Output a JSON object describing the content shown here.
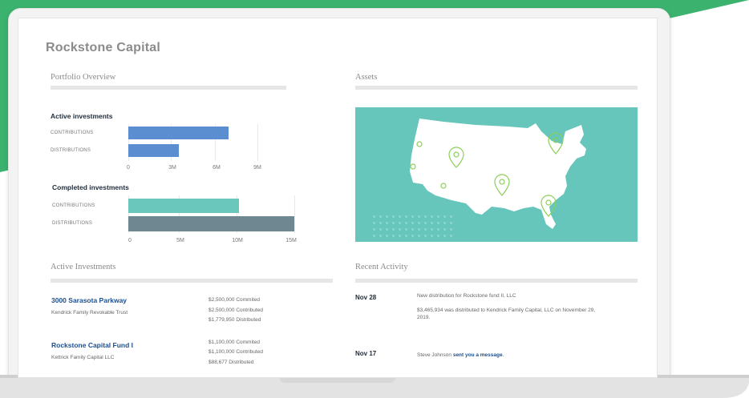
{
  "app": {
    "title": "Rockstone Capital"
  },
  "sections": {
    "portfolio_overview": "Portfolio Overview",
    "assets": "Assets",
    "active_investments": "Active Investments",
    "recent_activity": "Recent Activity"
  },
  "charts_text": {
    "active_title": "Active investments",
    "completed_title": "Completed investments",
    "contributions": "CONTRIBUTIONS",
    "distributions": "DISTRIBUTIONS"
  },
  "chart_data": [
    {
      "type": "bar",
      "title": "Active investments",
      "categories": [
        "CONTRIBUTIONS",
        "DISTRIBUTIONS"
      ],
      "values": [
        7.0,
        3.5
      ],
      "xlim": [
        0,
        9
      ],
      "ticks": [
        "0",
        "3M",
        "6M",
        "9M"
      ],
      "colors": [
        "#5b8ed1",
        "#5b8ed1"
      ],
      "orientation": "horizontal"
    },
    {
      "type": "bar",
      "title": "Completed investments",
      "categories": [
        "CONTRIBUTIONS",
        "DISTRIBUTIONS"
      ],
      "values": [
        10.0,
        15.0
      ],
      "xlim": [
        0,
        15
      ],
      "ticks": [
        "0",
        "5M",
        "10M",
        "15M"
      ],
      "colors": [
        "#69c7bb",
        "#6f8790"
      ],
      "orientation": "horizontal"
    }
  ],
  "investments": [
    {
      "name": "3000 Sarasota Parkway",
      "owner": "Kendrick Family Revokable Trust",
      "lines": [
        "$2,500,000 Commited",
        "$2,500,000 Contributed",
        "$1,779,950 Distributed"
      ]
    },
    {
      "name": "Rockstone Capital Fund I",
      "owner": "Kettrick Family Capital LLC",
      "lines": [
        "$1,100,000 Commited",
        "$1,100,000 Contributed",
        "$88,677 Distributed"
      ]
    }
  ],
  "activity": [
    {
      "date": "Nov 28",
      "line1": "New distribution for Rockstone fund II, LLC",
      "line2": "$3,465,934 was distributed to Kendrick Family Capital, LLC on November 29, 2019."
    },
    {
      "date": "Nov 17",
      "prefix": "Steve Johnson",
      "link": "sent you a message",
      "suffix": "."
    }
  ],
  "colors": {
    "green_accent": "#3bb26e",
    "map_bg": "#66c6bb",
    "pin": "#8bcf55",
    "link": "#1d4f8f"
  },
  "icons": [
    "map-pin-icon"
  ]
}
